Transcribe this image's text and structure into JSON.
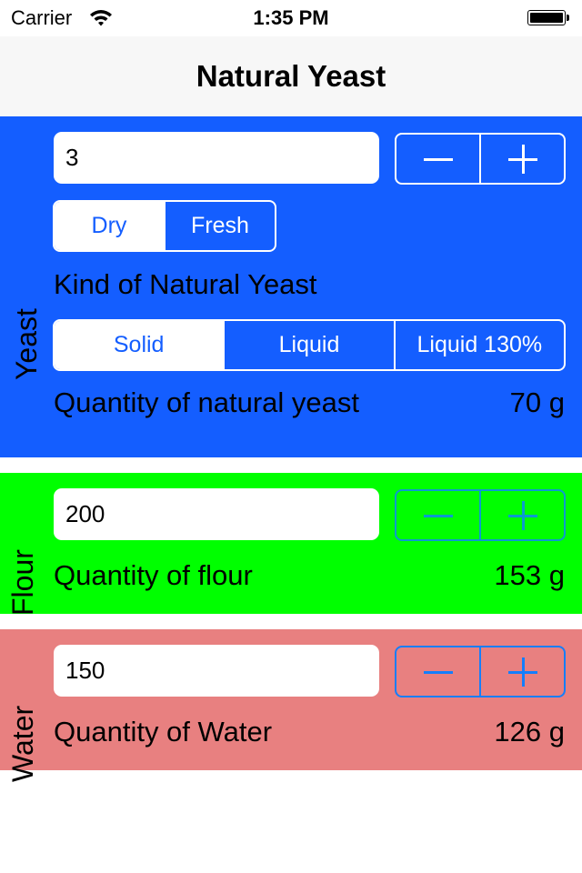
{
  "status_bar": {
    "carrier": "Carrier",
    "time": "1:35 PM",
    "wifi_icon": "wifi-icon",
    "battery_icon": "battery-full-icon"
  },
  "nav": {
    "title": "Natural Yeast"
  },
  "colors": {
    "yeast_bg": "#145eff",
    "flour_bg": "#00ff00",
    "water_bg": "#e88080",
    "tint": "#157efb"
  },
  "yeast": {
    "section_label": "Yeast",
    "input_value": "3",
    "stepper": {
      "minus_icon": "minus-icon",
      "plus_icon": "plus-icon"
    },
    "type_segments": [
      {
        "label": "Dry",
        "selected": true
      },
      {
        "label": "Fresh",
        "selected": false
      }
    ],
    "kind_label": "Kind of Natural Yeast",
    "kind_segments": [
      {
        "label": "Solid",
        "selected": true
      },
      {
        "label": "Liquid",
        "selected": false
      },
      {
        "label": "Liquid 130%",
        "selected": false
      }
    ],
    "quantity_label": "Quantity of natural yeast",
    "quantity_value": "70 g"
  },
  "flour": {
    "section_label": "Flour",
    "input_value": "200",
    "quantity_label": "Quantity of flour",
    "quantity_value": "153 g"
  },
  "water": {
    "section_label": "Water",
    "input_value": "150",
    "quantity_label": "Quantity of Water",
    "quantity_value": "126 g"
  }
}
